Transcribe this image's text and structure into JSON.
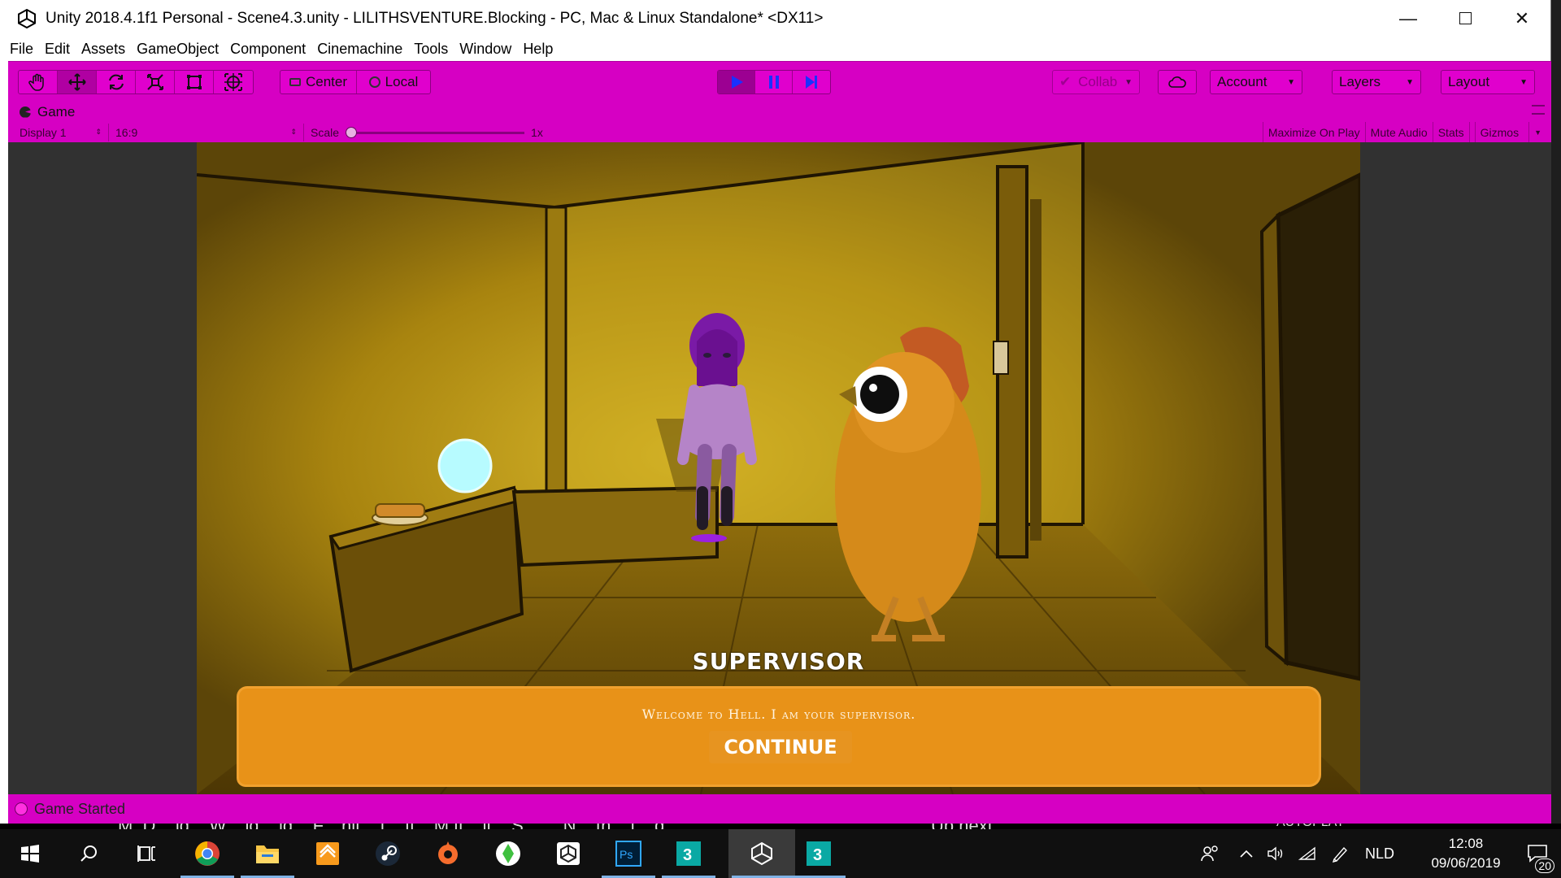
{
  "window": {
    "title": "Unity 2018.4.1f1 Personal - Scene4.3.unity - LILITHSVENTURE.Blocking - PC, Mac & Linux Standalone* <DX11>",
    "controls": [
      "minimize-icon",
      "maximize-icon",
      "close-icon"
    ]
  },
  "menu": [
    "File",
    "Edit",
    "Assets",
    "GameObject",
    "Component",
    "Cinemachine",
    "Tools",
    "Window",
    "Help"
  ],
  "toolbar": {
    "tools": [
      "hand-tool-icon",
      "move-tool-icon",
      "rotate-tool-icon",
      "scale-tool-icon",
      "rect-tool-icon",
      "transform-tool-icon"
    ],
    "active_tool": "move",
    "pivot_mode": "Center",
    "pivot_rotation": "Local",
    "playing": true,
    "collab": "Collab",
    "account": "Account",
    "layers": "Layers",
    "layout": "Layout",
    "accent": "#d600c3"
  },
  "game_view": {
    "tab_label": "Game",
    "display": "Display 1",
    "aspect": "16:9",
    "scale_label": "Scale",
    "scale_value": "1x",
    "right_options": [
      "Maximize On Play",
      "Mute Audio",
      "Stats",
      "Gizmos"
    ]
  },
  "scene": {
    "speaker": "SUPERVISOR",
    "message": "Welcome to Hell. I am your supervisor.",
    "continue_label": "CONTINUE"
  },
  "status": {
    "text": "Game Started"
  },
  "background_text": {
    "left": "M. D... ld... W... ld... ld... F... nit... t... ti... M ti... lt... S... ... N... th... l... d",
    "mid": "Up next",
    "right": "AUTOPLAY"
  },
  "taskbar": {
    "apps": [
      "windows-start-icon",
      "search-icon",
      "task-view-icon",
      "chrome-icon",
      "file-explorer-icon",
      "app-icon",
      "steam-icon",
      "origin-icon",
      "sims-icon",
      "unity-hub-icon",
      "photoshop-icon",
      "3dsmax-icon",
      "unity-icon",
      "3dsmax-icon-2"
    ],
    "language": "NLD",
    "time": "12:08",
    "date": "09/06/2019",
    "notifications": "20"
  }
}
